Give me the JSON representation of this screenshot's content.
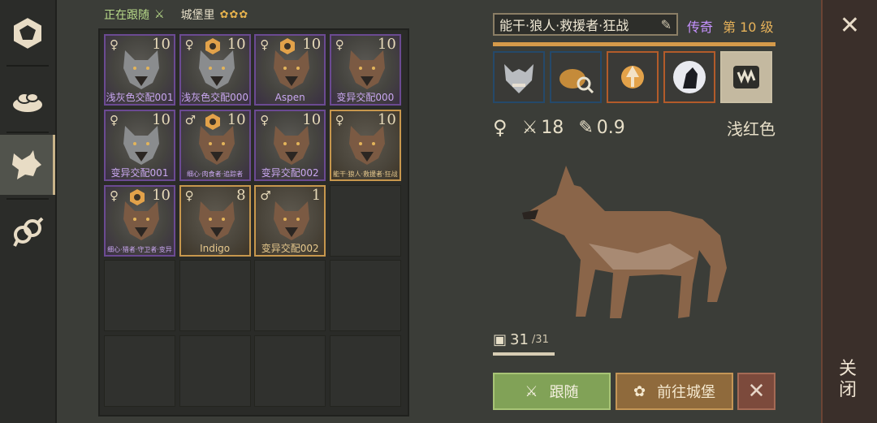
{
  "status": {
    "follow_label": "正在跟随",
    "castle_label": "城堡里",
    "castle_gears": "✿✿✿"
  },
  "cells": [
    {
      "level": "10",
      "name": "浅灰色交配001",
      "sex": "♀",
      "badge": false,
      "tone": "grey",
      "frame": "purple"
    },
    {
      "level": "10",
      "name": "浅灰色交配000",
      "sex": "♀",
      "badge": true,
      "tone": "grey",
      "frame": "purple"
    },
    {
      "level": "10",
      "name": "Aspen",
      "sex": "♀",
      "badge": true,
      "tone": "brown",
      "frame": "purple"
    },
    {
      "level": "10",
      "name": "变异交配000",
      "sex": "♀",
      "badge": false,
      "tone": "brown",
      "frame": "purple"
    },
    {
      "level": "10",
      "name": "变异交配001",
      "sex": "♀",
      "badge": false,
      "tone": "grey",
      "frame": "purple"
    },
    {
      "level": "10",
      "name": "细心·肉食者·追踪者",
      "sex": "♂",
      "badge": true,
      "tone": "brown",
      "frame": "purple"
    },
    {
      "level": "10",
      "name": "变异交配002",
      "sex": "♀",
      "badge": false,
      "tone": "brown",
      "frame": "purple"
    },
    {
      "level": "10",
      "name": "能干·狼人·救援者·狂战",
      "sex": "♀",
      "badge": false,
      "tone": "brown",
      "frame": "gold"
    },
    {
      "level": "10",
      "name": "细心·猎者·守卫者·变异",
      "sex": "♀",
      "badge": true,
      "tone": "brown",
      "frame": "purple"
    },
    {
      "level": "8",
      "name": "Indigo",
      "sex": "♀",
      "badge": false,
      "tone": "brown",
      "frame": "gold"
    },
    {
      "level": "1",
      "name": "变异交配002",
      "sex": "♂",
      "badge": false,
      "tone": "brown",
      "frame": "gold"
    }
  ],
  "detail": {
    "title": "能干·狼人·救援者·狂战",
    "rarity": "传奇",
    "level_text": "第 10 级",
    "xp_fraction": 1.0,
    "stat_attack": "18",
    "stat_speed": "0.9",
    "color_name": "浅红色",
    "food": "31",
    "food_max": "/31",
    "food_fraction": 1.0
  },
  "buttons": {
    "follow": "跟随",
    "castle": "前往城堡",
    "cancel": "✕"
  },
  "close": {
    "x": "✕",
    "label": "关闭"
  },
  "colors": {
    "purple_frame": "#6b4a92",
    "gold_frame": "#c7974d",
    "legend": "#c692ff",
    "level": "#e8b35a"
  }
}
